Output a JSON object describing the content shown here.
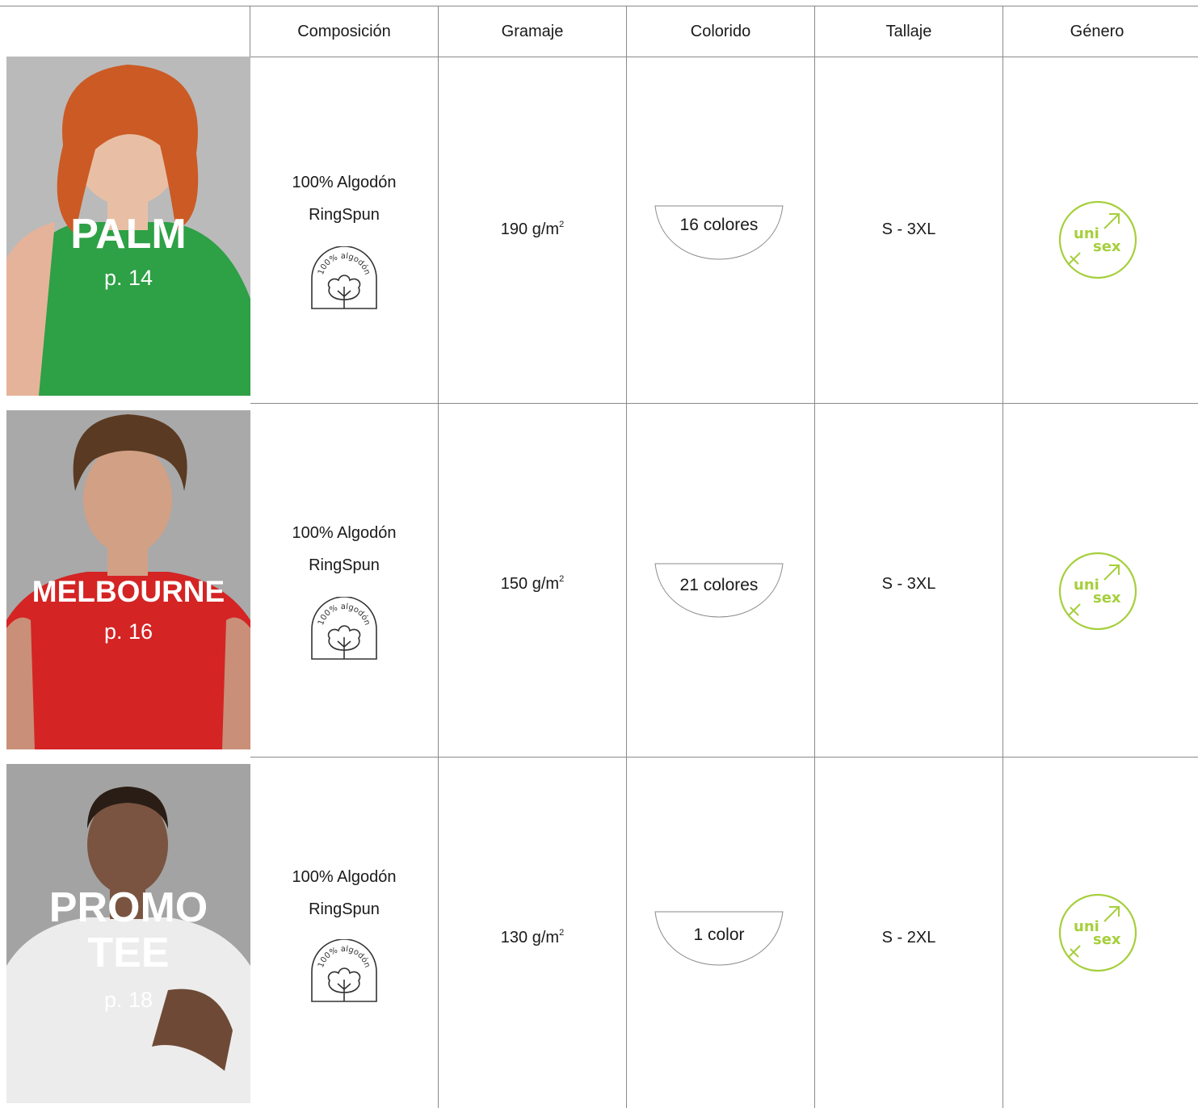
{
  "header": {
    "columns": [
      "Composición",
      "Gramaje",
      "Colorido",
      "Tallaje",
      "Género"
    ]
  },
  "products": [
    {
      "name_lines": [
        "PALM"
      ],
      "page": "p. 14",
      "shirt_color": "#2ea045",
      "composition": [
        "100% Algodón",
        "RingSpun"
      ],
      "badge_text": "100% algodón",
      "weight": "190 g/m",
      "weight_sup": "2",
      "colors": "16 colores",
      "sizes": "S - 3XL",
      "gender": [
        "uni",
        "sex"
      ]
    },
    {
      "name_lines": [
        "MELBOURNE"
      ],
      "page": "p. 16",
      "shirt_color": "#d42424",
      "composition": [
        "100% Algodón",
        "RingSpun"
      ],
      "badge_text": "100% algodón",
      "weight": "150 g/m",
      "weight_sup": "2",
      "colors": "21 colores",
      "sizes": "S - 3XL",
      "gender": [
        "uni",
        "sex"
      ]
    },
    {
      "name_lines": [
        "PROMO",
        "TEE"
      ],
      "page": "p. 18",
      "shirt_color": "#ececec",
      "composition": [
        "100% Algodón",
        "RingSpun"
      ],
      "badge_text": "100% algodón",
      "weight": "130 g/m",
      "weight_sup": "2",
      "colors": "1 color",
      "sizes": "S - 2XL",
      "gender": [
        "uni",
        "sex"
      ]
    }
  ],
  "colors": {
    "line": "#8a8a8a",
    "photo_bg": "#b3b3b3",
    "unisex_green": "#a6cf3c",
    "badge_stroke": "#333333"
  }
}
